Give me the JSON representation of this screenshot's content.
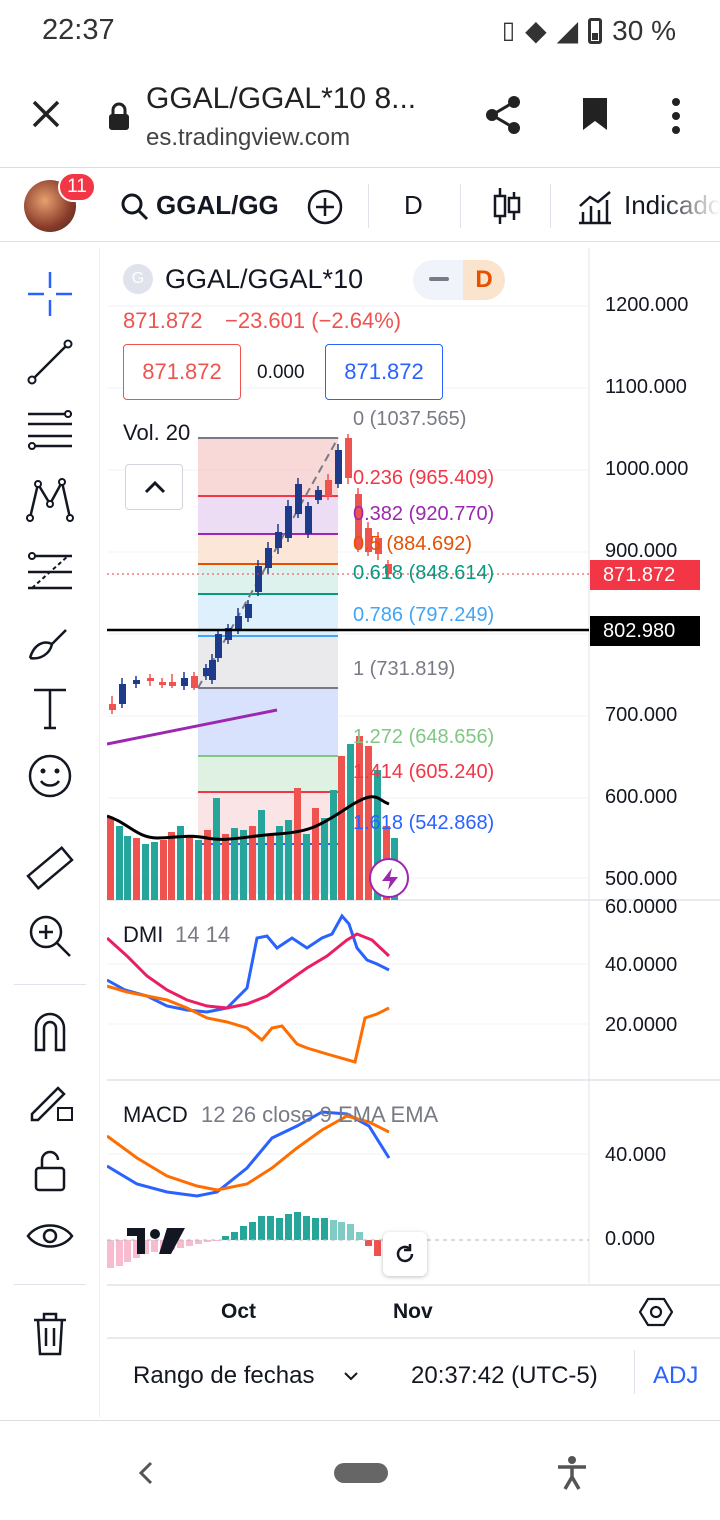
{
  "status": {
    "time": "22:37",
    "battery": "30 %"
  },
  "browser": {
    "title": "GGAL/GGAL*10 8...",
    "domain": "es.tradingview.com"
  },
  "toolbar": {
    "badge": "11",
    "symbol": "GGAL/GG",
    "interval": "D",
    "indicators": "Indicado"
  },
  "legend": {
    "symbol": "GGAL/GGAL*10",
    "logo": "G",
    "interval": "D",
    "price": "871.872",
    "change": "−23.601 (−2.64%)",
    "bid": "871.872",
    "spread": "0.000",
    "ask": "871.872",
    "volume": "Vol. 20"
  },
  "fib_levels": [
    {
      "label": "0 (1037.565)",
      "color": "#787b86"
    },
    {
      "label": "0.236 (965.409)",
      "color": "#f23645"
    },
    {
      "label": "0.382 (920.770)",
      "color": "#9c27b0"
    },
    {
      "label": "0.5 (884.692)",
      "color": "#e65100"
    },
    {
      "label": "0.618 (848.614)",
      "color": "#089981"
    },
    {
      "label": "0.786 (797.249)",
      "color": "#42a5f5"
    },
    {
      "label": "1 (731.819)",
      "color": "#787b86"
    },
    {
      "label": "1.272 (648.656)",
      "color": "#81c784"
    },
    {
      "label": "1.414 (605.240)",
      "color": "#f23645"
    },
    {
      "label": "1.618 (542.868)",
      "color": "#2962ff"
    }
  ],
  "price_axis": [
    "1200.000",
    "1100.000",
    "1000.000",
    "900.000",
    "700.000",
    "600.000",
    "500.000"
  ],
  "price_tags": {
    "last": "871.872",
    "line": "802.980"
  },
  "dmi": {
    "title": "DMI",
    "params": "14 14",
    "axis": [
      "60.0000",
      "40.0000",
      "20.0000"
    ]
  },
  "macd": {
    "title": "MACD",
    "params": "12 26 close 9 EMA EMA",
    "axis": [
      "40.000",
      "0.000"
    ]
  },
  "time_axis": [
    "Oct",
    "Nov"
  ],
  "footer": {
    "range": "Rango de fechas",
    "clock": "20:37:42 (UTC-5)",
    "adj": "ADJ"
  },
  "colors": {
    "up": "#26a69a",
    "down": "#ef5350",
    "accent": "#2962ff",
    "candle_up": "#1e3a8a"
  }
}
